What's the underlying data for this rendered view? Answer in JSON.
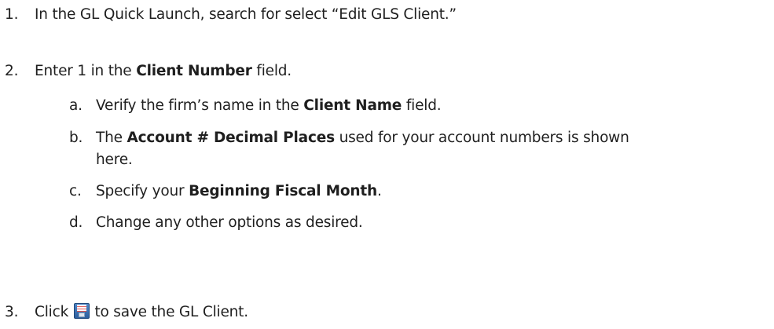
{
  "steps": [
    {
      "number": "1.",
      "text": "In the GL Quick Launch, search for select “Edit GLS Client.”"
    },
    {
      "number": "2.",
      "before": "Enter 1 in the ",
      "bold": "Client Number",
      "after": " field.",
      "substeps": [
        {
          "letter": "a.",
          "before": "Verify the firm’s name in the ",
          "bold": "Client Name",
          "after": " field."
        },
        {
          "letter": "b.",
          "before": "The ",
          "bold": "Account # Decimal Places",
          "after": " used for your account numbers is shown",
          "cont": "here."
        },
        {
          "letter": "c.",
          "before": "Specify your ",
          "bold": "Beginning Fiscal Month",
          "after": "."
        },
        {
          "letter": "d.",
          "before": "Change any other options as desired.",
          "bold": "",
          "after": ""
        }
      ]
    },
    {
      "number": "3.",
      "before": "Click ",
      "icon": "save-disk-icon",
      "after": " to save the GL Client."
    }
  ]
}
